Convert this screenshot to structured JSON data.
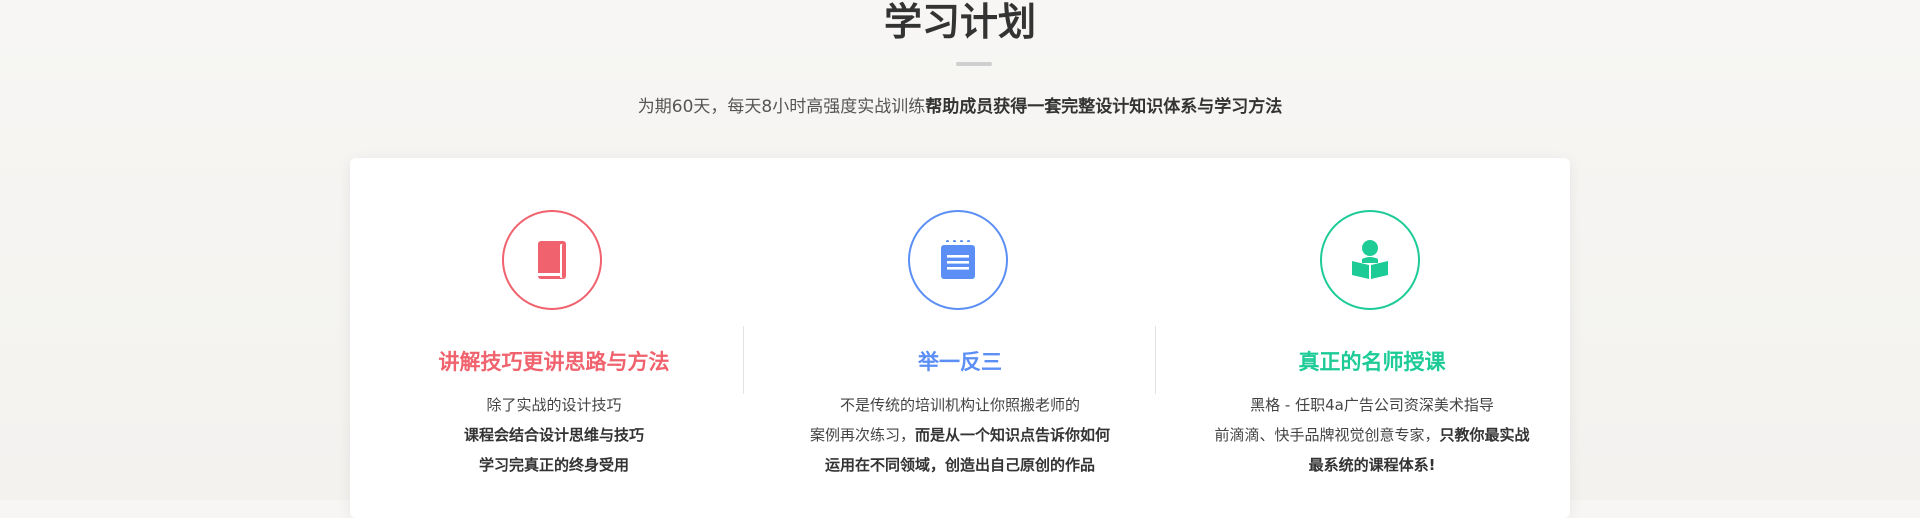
{
  "section": {
    "title": "学习计划",
    "subtitle_plain": "为期60天，每天8小时高强度实战训练",
    "subtitle_bold": "帮助成员获得一套完整设计知识体系与学习方法"
  },
  "features": [
    {
      "icon": "book-icon",
      "color": "#f0626d",
      "title": "讲解技巧更讲思路与方法",
      "lines": [
        {
          "plain": "除了实战的设计技巧",
          "bold": ""
        },
        {
          "plain": "",
          "bold": "课程会结合设计思维与技巧"
        },
        {
          "plain": "",
          "bold": "学习完真正的终身受用"
        }
      ]
    },
    {
      "icon": "notepad-icon",
      "color": "#5b8ff5",
      "title": "举一反三",
      "lines": [
        {
          "plain": "不是传统的培训机构让你照搬老师的",
          "bold": ""
        },
        {
          "plain": "案例再次练习，",
          "bold": "而是从一个知识点告诉你如何"
        },
        {
          "plain": "",
          "bold": "运用在不同领域，创造出自己原创的作品"
        }
      ]
    },
    {
      "icon": "reader-icon",
      "color": "#1ccb96",
      "title": "真正的名师授课",
      "lines": [
        {
          "plain": "黑格 - 任职4a广告公司资深美术指导",
          "bold": ""
        },
        {
          "plain": "前滴滴、快手品牌视觉创意专家，",
          "bold": "只教你最实战"
        },
        {
          "plain": "",
          "bold": "最系统的课程体系!"
        }
      ]
    }
  ]
}
